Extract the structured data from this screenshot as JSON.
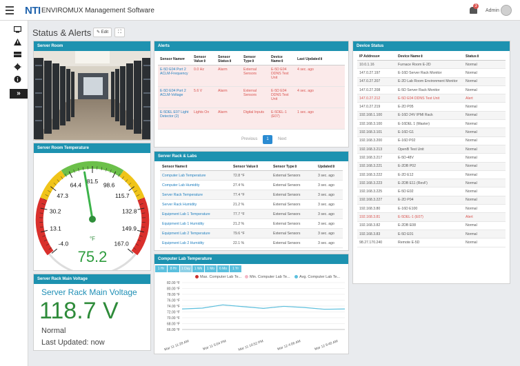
{
  "header": {
    "logo": "NTI",
    "app_title": "ENVIROMUX Management Software",
    "notification_count": "3",
    "user": "Admin"
  },
  "page": {
    "title": "Status & Alerts",
    "edit_label": "Edit",
    "expand_label": "⛶"
  },
  "sidebar": {
    "items": [
      {
        "icon": "monitor-icon"
      },
      {
        "icon": "warning-icon"
      },
      {
        "icon": "server-icon"
      },
      {
        "icon": "gear-icon"
      },
      {
        "icon": "info-icon"
      }
    ],
    "expand_label": "»"
  },
  "server_room": {
    "title": "Server Room"
  },
  "gauge": {
    "title": "Server Room Temperature",
    "value": "75.2",
    "unit": "°F",
    "ticks": [
      "-4.0",
      "13.1",
      "30.2",
      "47.3",
      "64.4",
      "81.5",
      "98.6",
      "115.7",
      "132.8",
      "149.9",
      "167.0"
    ]
  },
  "voltage": {
    "panel_title": "Server Rack Main Voltage",
    "heading": "Server Rack Main Voltage",
    "value": "118.7 V",
    "status": "Normal",
    "updated": "Last Updated: now"
  },
  "alerts": {
    "title": "Alerts",
    "headers": [
      "Sensor Name",
      "Sensor Value",
      "Sensor Status",
      "Sensor Type",
      "Device Name",
      "Last Updated"
    ],
    "rows": [
      [
        "E-5D E04 Port 2 ACLM-Frequency",
        "0.0 Hz",
        "Alarm",
        "External Sensors",
        "E-5D E04 DDNS Test Unit",
        "4 sec. ago"
      ],
      [
        "E-5D E04 Port 2 ACLM-Voltage",
        "5.6 V",
        "Alarm",
        "External Sensors",
        "E-5D E04 DDNS Test Unit",
        "4 sec. ago"
      ],
      [
        "E-5DEL E07 Light Detector (2)",
        "Lights On",
        "Alarm",
        "Digital Inputs",
        "E-5DEL-1 (E07)",
        "1 sec. ago"
      ]
    ],
    "previous": "Previous",
    "page": "1",
    "next": "Next"
  },
  "rack": {
    "title": "Server Rack & Labs",
    "headers": [
      "Sensor Name",
      "Sensor Value",
      "Sensor Type",
      "Updated"
    ],
    "rows": [
      [
        "Computer Lab Temperature",
        "72.8 °F",
        "External Sensors",
        "3 sec. ago"
      ],
      [
        "Computer Lab Humidity",
        "27.4 %",
        "External Sensors",
        "3 sec. ago"
      ],
      [
        "Server Rack Temperature",
        "77.4 °F",
        "External Sensors",
        "3 sec. ago"
      ],
      [
        "Server Rack Humidity",
        "21.2 %",
        "External Sensors",
        "3 sec. ago"
      ],
      [
        "Equipment Lab 1 Temperature",
        "77.7 °F",
        "External Sensors",
        "3 sec. ago"
      ],
      [
        "Equipment Lab 1 Humidity",
        "21.2 %",
        "External Sensors",
        "3 sec. ago"
      ],
      [
        "Equipment Lab 2 Temperature",
        "79.6 °F",
        "External Sensors",
        "3 sec. ago"
      ],
      [
        "Equipment Lab 2 Humidity",
        "22.1 %",
        "External Sensors",
        "3 sec. ago"
      ]
    ]
  },
  "lab_chart": {
    "title": "Computer Lab Temperature",
    "ranges": [
      "1 Hr",
      "8 Hr",
      "1 Day",
      "1 Wk",
      "1 Mo",
      "6 Mo",
      "1 Yr"
    ],
    "active_range": "1 Day",
    "colors": {
      "max": "#c9302c",
      "min": "#f2b8c6",
      "avg": "#5bc0de"
    }
  },
  "chart_data": {
    "type": "line",
    "x": [
      "Mar 11 11:28 AM",
      "Mar 11 5:04 PM",
      "Mar 11 10:52 PM",
      "Mar 12 4:06 AM",
      "Mar 12 9:40 AM"
    ],
    "series": [
      {
        "name": "Max. Computer Lab Te...",
        "values": [
          73.0,
          73.3,
          74.4,
          73.8,
          73.2,
          73.9,
          73.5,
          72.9,
          73.0
        ]
      },
      {
        "name": "Min. Computer Lab Te...",
        "values": [
          73.0,
          73.3,
          74.4,
          73.8,
          73.2,
          73.9,
          73.5,
          72.9,
          73.0
        ]
      },
      {
        "name": "Avg. Computer Lab Te...",
        "values": [
          73.0,
          73.3,
          74.4,
          73.8,
          73.2,
          73.9,
          73.5,
          72.9,
          73.0
        ]
      }
    ],
    "yticks": [
      "82.00 °F",
      "80.00 °F",
      "78.00 °F",
      "76.00 °F",
      "74.00 °F",
      "72.00 °F",
      "70.00 °F",
      "68.00 °F",
      "66.00 °F"
    ],
    "ylim": [
      66,
      82
    ]
  },
  "devices": {
    "title": "Device Status",
    "headers": [
      "IP Address",
      "Device Name",
      "Status"
    ],
    "rows": [
      [
        "10.0.1.16",
        "Furnace Room E-2D",
        "Normal"
      ],
      [
        "147.0.27.197",
        "E-16D Server Rack Monitor",
        "Normal"
      ],
      [
        "147.0.27.207",
        "E-2D Lab Room Environment Monitor",
        "Normal"
      ],
      [
        "147.0.27.208",
        "E-5D Server Rack Monitor",
        "Normal"
      ],
      [
        "147.0.27.212",
        "E-5D E04 DDNS Test Unit",
        "Alert"
      ],
      [
        "147.0.27.219",
        "E-2D P05",
        "Normal"
      ],
      [
        "192.168.1.100",
        "E-16D 24V IPMI Rack",
        "Normal"
      ],
      [
        "192.168.3.100",
        "E-16DEL 1 (Master)",
        "Normal"
      ],
      [
        "192.168.3.101",
        "E-16D G1",
        "Normal"
      ],
      [
        "192.168.3.200",
        "E-16D P02",
        "Normal"
      ],
      [
        "192.168.3.213",
        "OpenB Test Unit",
        "Normal"
      ],
      [
        "192.168.3.217",
        "E-5D-48V",
        "Normal"
      ],
      [
        "192.168.3.221",
        "E-2DB P02",
        "Normal"
      ],
      [
        "192.168.3.222",
        "E-2D E12",
        "Normal"
      ],
      [
        "192.168.3.223",
        "E-2DB E11 (RevF)",
        "Normal"
      ],
      [
        "192.168.3.225",
        "E-5D E02",
        "Normal"
      ],
      [
        "192.168.3.227",
        "E-2D P04",
        "Normal"
      ],
      [
        "192.168.3.80",
        "E-16D E100",
        "Normal"
      ],
      [
        "192.168.3.81",
        "E-5DEL-1 (E07)",
        "Alert"
      ],
      [
        "192.168.3.82",
        "E-2DB E08",
        "Normal"
      ],
      [
        "192.168.3.83",
        "E-5D E01",
        "Normal"
      ],
      [
        "98.27.170.240",
        "Remote E-5D",
        "Normal"
      ]
    ]
  }
}
